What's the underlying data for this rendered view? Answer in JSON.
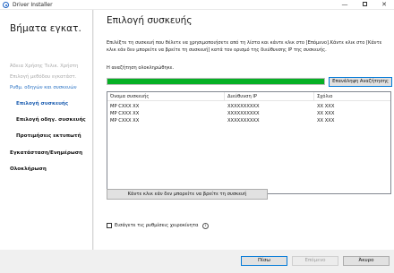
{
  "window": {
    "title": "Driver Installer"
  },
  "sidebar": {
    "heading": "Βήματα εγκατ.",
    "items": [
      {
        "label": "Άδεια Χρήσης Τελικ. Χρήστη"
      },
      {
        "label": "Επιλογή μεθόδου εγκατάστ."
      },
      {
        "label": "Ρυθμ. οδηγών και συσκευών"
      },
      {
        "label": "Επιλογή συσκευής"
      },
      {
        "label": "Επιλογή οδηγ. συσκευής"
      },
      {
        "label": "Προτιμήσεις εκτυπωτή"
      },
      {
        "label": "Εγκατάσταση/Ενημέρωση"
      },
      {
        "label": "Ολοκλήρωση"
      }
    ]
  },
  "main": {
    "title": "Επιλογή συσκευής",
    "description": "Επιλέξτε τη συσκευή που θέλετε να χρησιμοποιήσετε από τη λίστα και κάντε κλικ στο [Επόμενο].Κάντε κλικ στο [Κάντε κλικ εάν δεν μπορείτε να βρείτε τη συσκευή] κατά τον ορισμό της διεύθυνσης IP της συσκευής.",
    "status": "Η αναζήτηση ολοκληρώθηκε.",
    "progress": 1.0,
    "refresh_button": "Επανάληψη Αναζήτησης",
    "table": {
      "columns": [
        "Όνομα συσκευής",
        "Διεύθυνση IP",
        "Σχόλιο"
      ],
      "rows": [
        [
          "MP CXXX XX",
          "XXXXXXXXXX",
          "XX XXX"
        ],
        [
          "MP CXXX XX",
          "XXXXXXXXXX",
          "XX XXX"
        ],
        [
          "MP CXXX XX",
          "XXXXXXXXXX",
          "XX XXX"
        ]
      ]
    },
    "not_found_button": "Κάντε κλικ εάν δεν μπορείτε να βρείτε τη συσκευή",
    "advanced_checkbox": "Εισάγετε τις ρυθμίσεις χειροκίνητα"
  },
  "footer": {
    "back": "Πίσω",
    "next": "Επόμενο",
    "cancel": "Άκυρο"
  },
  "colors": {
    "accent": "#0078d7",
    "progress": "#06b025",
    "link": "#2a72c4"
  }
}
